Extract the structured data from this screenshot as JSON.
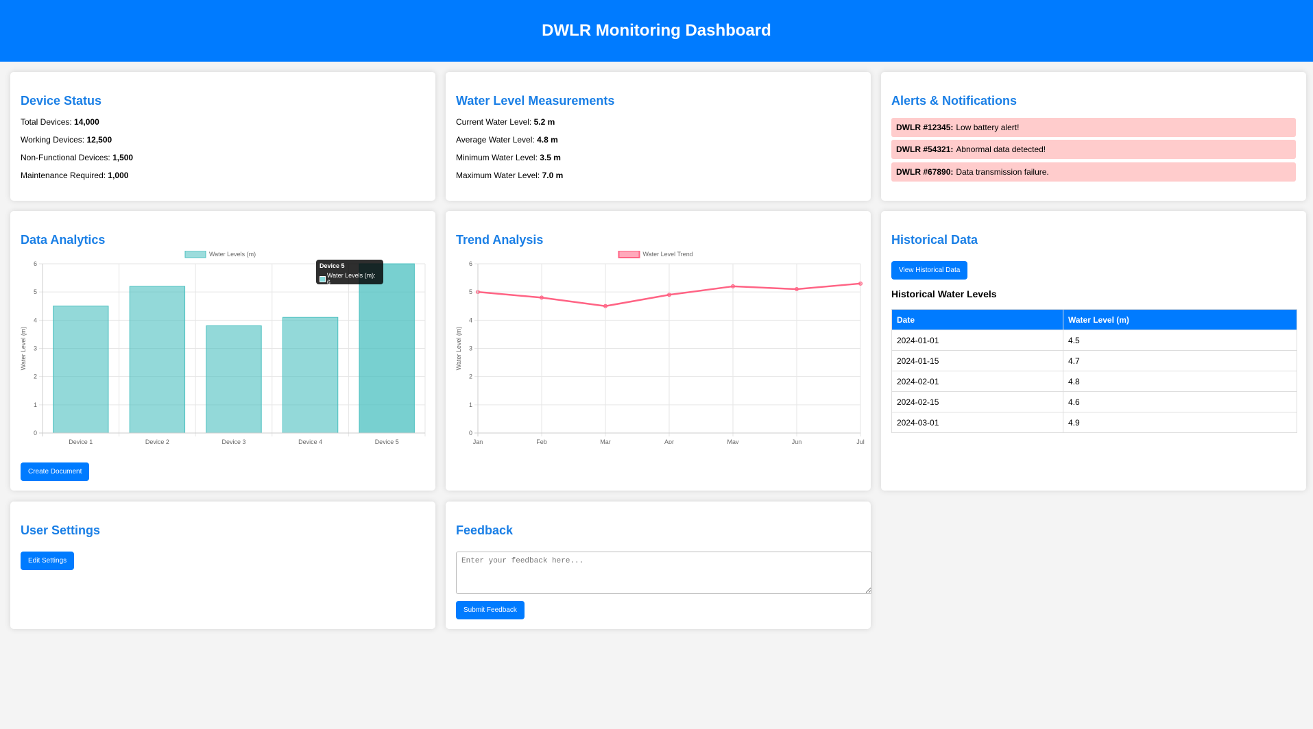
{
  "header": {
    "title": "DWLR Monitoring Dashboard"
  },
  "device_status": {
    "title": "Device Status",
    "stats": [
      {
        "label": "Total Devices:",
        "value": "14,000"
      },
      {
        "label": "Working Devices:",
        "value": "12,500"
      },
      {
        "label": "Non-Functional Devices:",
        "value": "1,500"
      },
      {
        "label": "Maintenance Required:",
        "value": "1,000"
      }
    ]
  },
  "water_level": {
    "title": "Water Level Measurements",
    "stats": [
      {
        "label": "Current Water Level:",
        "value": "5.2 m"
      },
      {
        "label": "Average Water Level:",
        "value": "4.8 m"
      },
      {
        "label": "Minimum Water Level:",
        "value": "3.5 m"
      },
      {
        "label": "Maximum Water Level:",
        "value": "7.0 m"
      }
    ]
  },
  "alerts": {
    "title": "Alerts & Notifications",
    "items": [
      {
        "id": "DWLR #12345:",
        "message": "Low battery alert!"
      },
      {
        "id": "DWLR #54321:",
        "message": "Abnormal data detected!"
      },
      {
        "id": "DWLR #67890:",
        "message": "Data transmission failure."
      }
    ]
  },
  "analytics": {
    "title": "Data Analytics",
    "button": "Create Document",
    "tooltip": {
      "title": "Device 5",
      "text": "Water Levels (m): 6"
    }
  },
  "trend": {
    "title": "Trend Analysis"
  },
  "historical": {
    "title": "Historical Data",
    "button": "View Historical Data",
    "subtitle": "Historical Water Levels",
    "headers": [
      "Date",
      "Water Level (m)"
    ],
    "rows": [
      [
        "2024-01-01",
        "4.5"
      ],
      [
        "2024-01-15",
        "4.7"
      ],
      [
        "2024-02-01",
        "4.8"
      ],
      [
        "2024-02-15",
        "4.6"
      ],
      [
        "2024-03-01",
        "4.9"
      ]
    ]
  },
  "user_settings": {
    "title": "User Settings",
    "button": "Edit Settings"
  },
  "feedback": {
    "title": "Feedback",
    "placeholder": "Enter your feedback here...",
    "button": "Submit Feedback"
  },
  "chart_data": [
    {
      "type": "bar",
      "categories": [
        "Device 1",
        "Device 2",
        "Device 3",
        "Device 4",
        "Device 5"
      ],
      "series": [
        {
          "name": "Water Levels (m)",
          "values": [
            4.5,
            5.2,
            3.8,
            4.1,
            6
          ]
        }
      ],
      "xlabel": "",
      "ylabel": "Water Level (m)",
      "ylim": [
        0,
        6
      ],
      "yticks": [
        0,
        1,
        2,
        3,
        4,
        5,
        6
      ],
      "color": "#4bc0c0",
      "highlight_index": 4,
      "grid": true,
      "legend": "top"
    },
    {
      "type": "line",
      "categories": [
        "Jan",
        "Feb",
        "Mar",
        "Apr",
        "May",
        "Jun",
        "Jul"
      ],
      "series": [
        {
          "name": "Water Level Trend",
          "values": [
            5,
            4.8,
            4.5,
            4.9,
            5.2,
            5.1,
            5.3
          ]
        }
      ],
      "xlabel": "",
      "ylabel": "Water Level (m)",
      "ylim": [
        0,
        6
      ],
      "yticks": [
        0,
        1,
        2,
        3,
        4,
        5,
        6
      ],
      "color": "#ff6384",
      "grid": true,
      "legend": "top"
    }
  ]
}
